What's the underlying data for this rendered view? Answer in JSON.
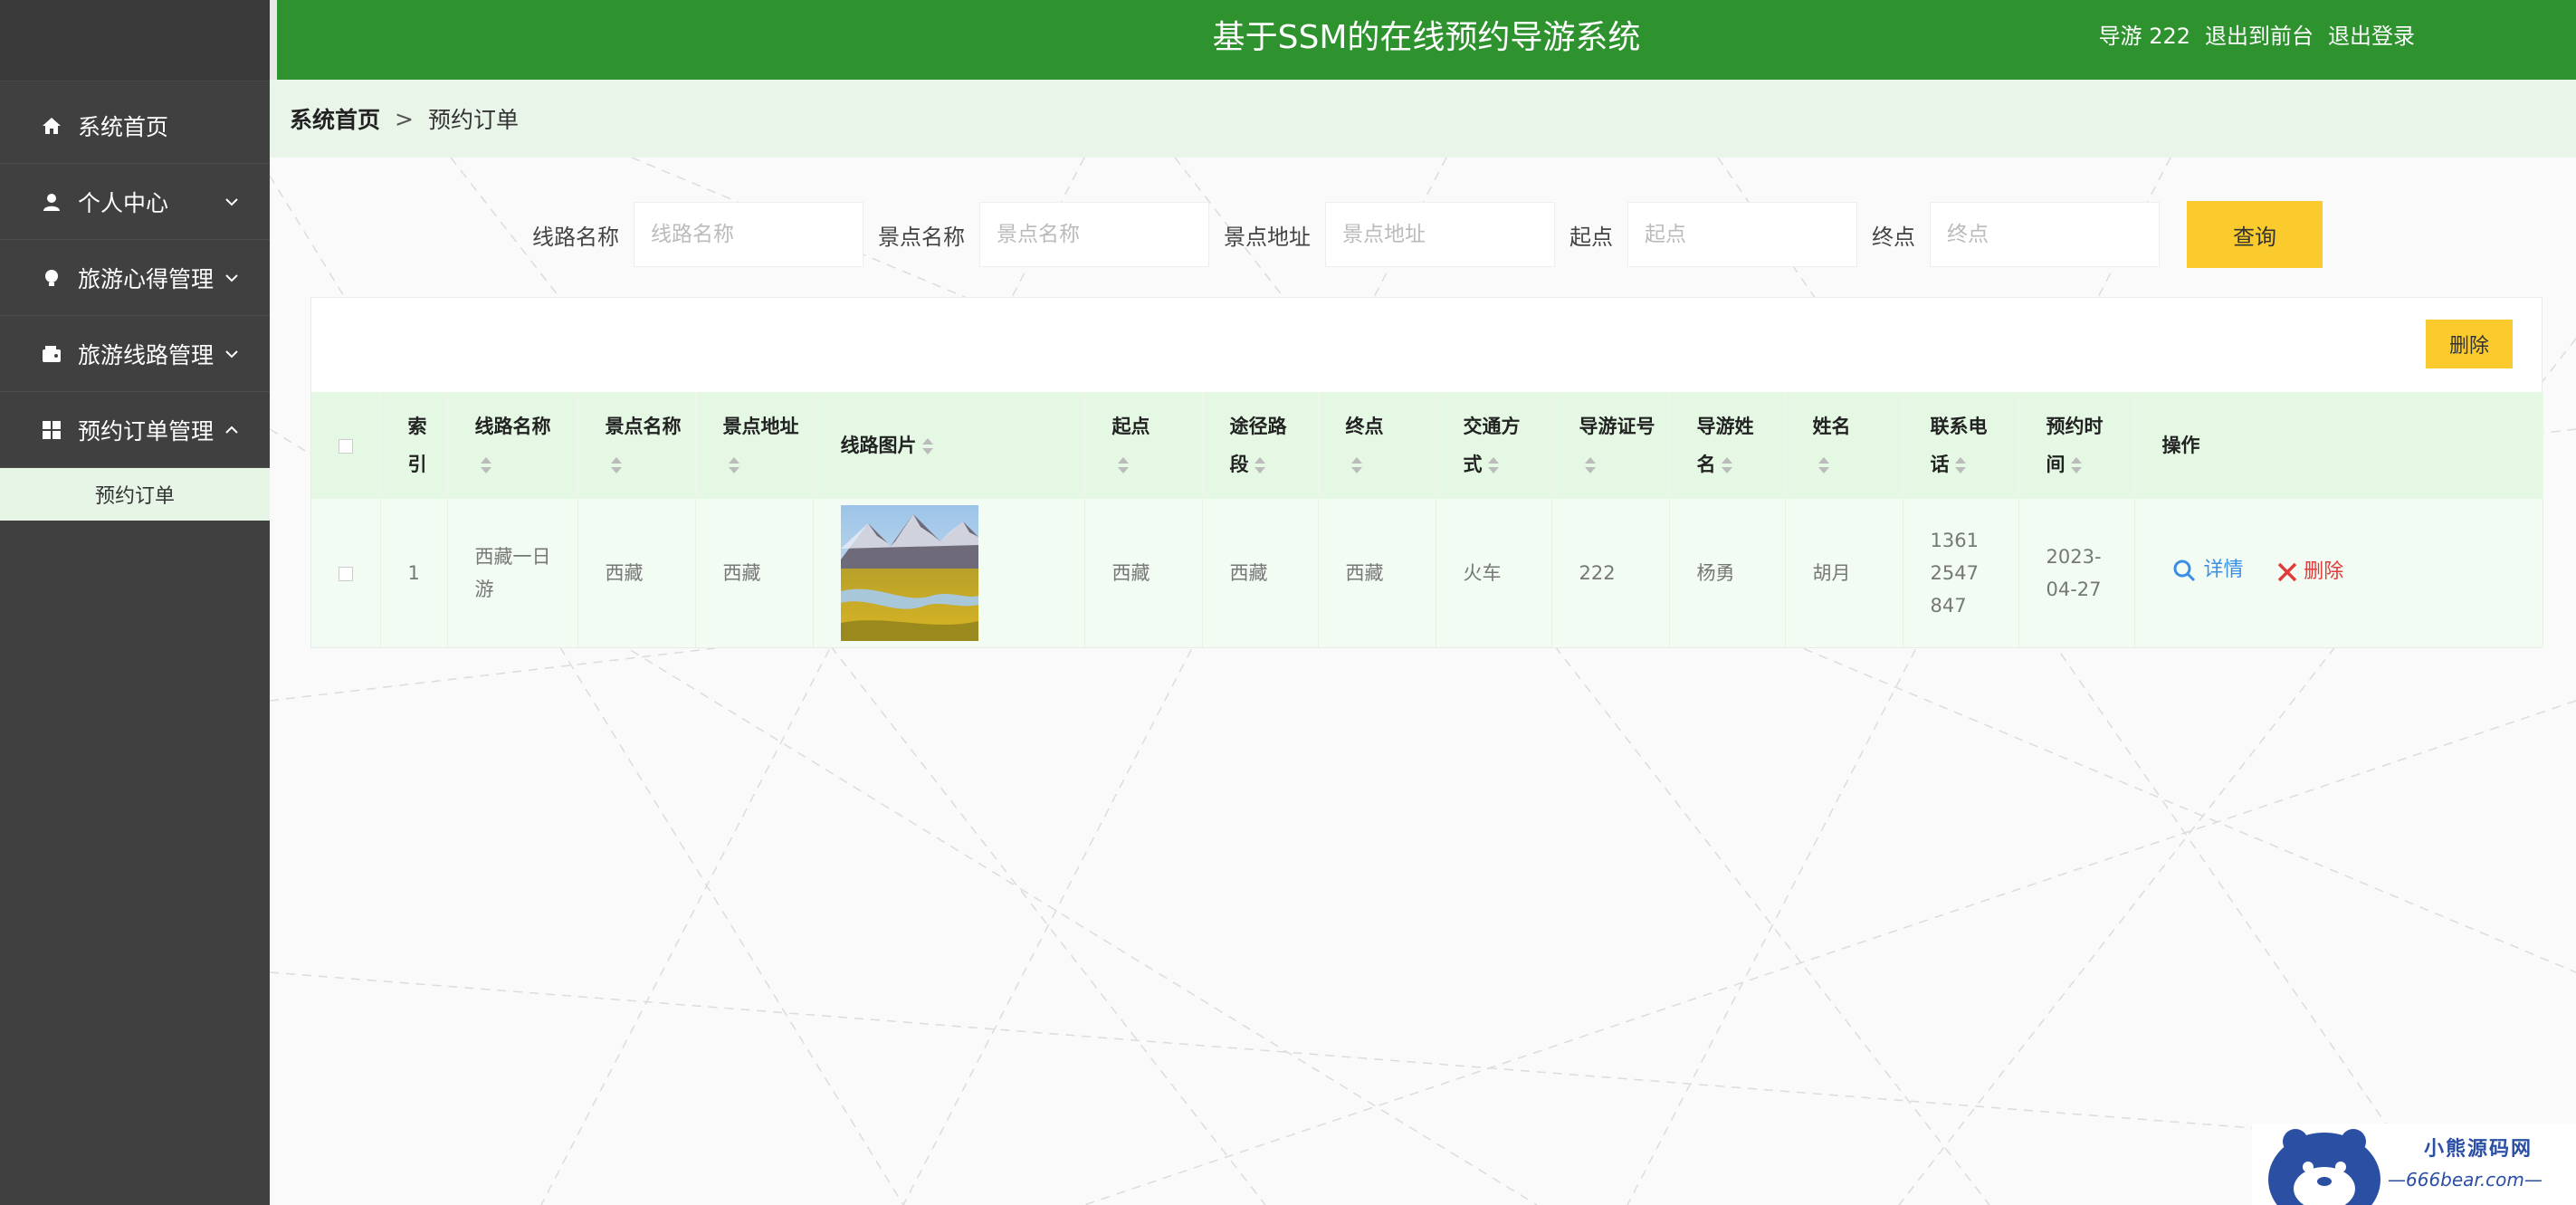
{
  "header": {
    "title": "基于SSM的在线预约导游系统",
    "user": "导游 222",
    "front": "退出到前台",
    "logout": "退出登录"
  },
  "sidebar": {
    "items": [
      {
        "label": "系统首页",
        "icon": "home-icon"
      },
      {
        "label": "个人中心",
        "icon": "user-icon"
      },
      {
        "label": "旅游心得管理",
        "icon": "bulb-icon"
      },
      {
        "label": "旅游线路管理",
        "icon": "wallet-icon"
      },
      {
        "label": "预约订单管理",
        "icon": "grid-icon"
      }
    ],
    "sub_item": "预约订单"
  },
  "breadcrumb": {
    "home": "系统首页",
    "sep": ">",
    "current": "预约订单"
  },
  "search": {
    "route_label": "线路名称",
    "route_placeholder": "线路名称",
    "spot_label": "景点名称",
    "spot_placeholder": "景点名称",
    "addr_label": "景点地址",
    "addr_placeholder": "景点地址",
    "start_label": "起点",
    "start_placeholder": "起点",
    "end_label": "终点",
    "end_placeholder": "终点",
    "button": "查询"
  },
  "toolbar": {
    "delete": "删除"
  },
  "table": {
    "headers": {
      "index": "索引",
      "route_name": "线路名称",
      "spot_name": "景点名称",
      "spot_addr": "景点地址",
      "route_img": "线路图片",
      "start": "起点",
      "via": "途径路段",
      "end": "终点",
      "transport": "交通方式",
      "guide_no": "导游证号",
      "guide_name": "导游姓名",
      "name": "姓名",
      "phone": "联系电话",
      "time": "预约时间",
      "ops": "操作"
    },
    "rows": [
      {
        "index": "1",
        "route_name": "西藏一日游",
        "spot_name": "西藏",
        "spot_addr": "西藏",
        "start": "西藏",
        "via": "西藏",
        "end": "西藏",
        "transport": "火车",
        "guide_no": "222",
        "guide_name": "杨勇",
        "name": "胡月",
        "phone": "13612547847",
        "time": "2023-04-27",
        "view": "详情",
        "delete": "删除"
      }
    ]
  },
  "watermark": {
    "title": "小熊源码网",
    "url": "—666bear.com—"
  }
}
